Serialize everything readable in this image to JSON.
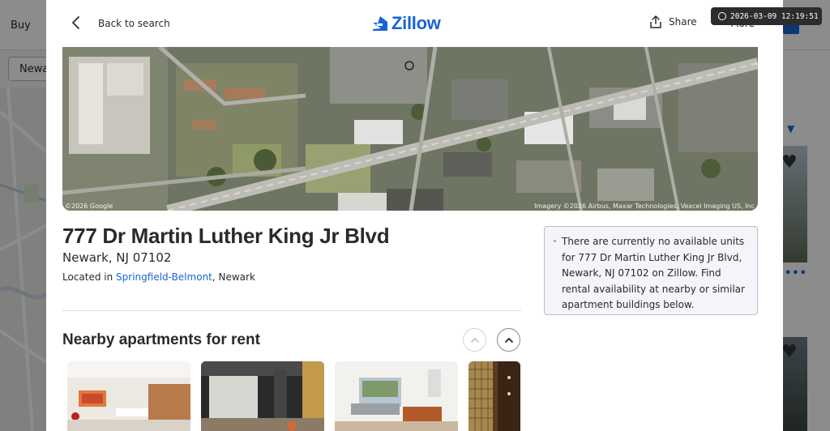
{
  "background": {
    "nav_buy": "Buy",
    "search_value": "Newa"
  },
  "header": {
    "back_label": "Back to search",
    "logo_text": "Zillow",
    "share_label": "Share",
    "more_label": "More"
  },
  "timestamp": "2026-03-09 12:19:51",
  "map": {
    "credit_left": "©2026 Google",
    "credit_right": "Imagery ©2026 Airbus, Maxar Technologies, Vexcel Imaging US, Inc"
  },
  "property": {
    "address": "777 Dr Martin Luther King Jr Blvd",
    "city_state_zip": "Newark, NJ 07102",
    "located_in_prefix": "Located in ",
    "neighborhood": "Springfield-Belmont",
    "city_suffix": ", Newark"
  },
  "notice": {
    "text": "There are currently no available units for 777 Dr Martin Luther King Jr Blvd, Newark, NJ 07102 on Zillow. Find rental availability at nearby or similar apartment buildings below."
  },
  "nearby": {
    "title": "Nearby apartments for rent"
  },
  "colors": {
    "brand_blue": "#1a63d6",
    "text_dark": "#2a2a2a"
  }
}
